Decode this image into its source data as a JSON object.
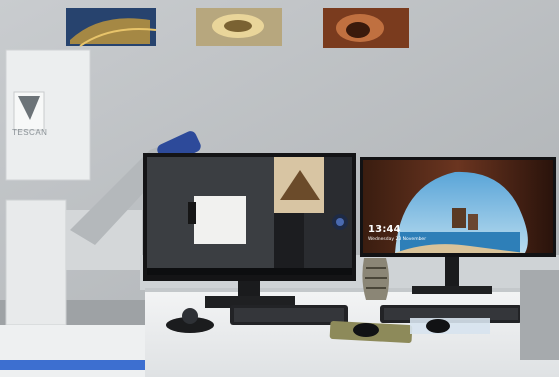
{
  "scene": {
    "brand_text": "TESCAN",
    "lock_screen": {
      "time": "13:44",
      "date": "Wednesday 23 November"
    },
    "objects": [
      "wall-poster",
      "wall-poster",
      "wall-poster",
      "electron-microscope",
      "desk",
      "left-monitor",
      "right-monitor",
      "keyboard",
      "keyboard",
      "mouse",
      "trackball",
      "mouse-pad",
      "vase"
    ],
    "colors": {
      "wall": "#c6c9cb",
      "desk": "#eef0f1",
      "monitor_frame": "#141416",
      "microscope_body": "#eceeef",
      "accent_blue": "#2d4a9a"
    }
  }
}
